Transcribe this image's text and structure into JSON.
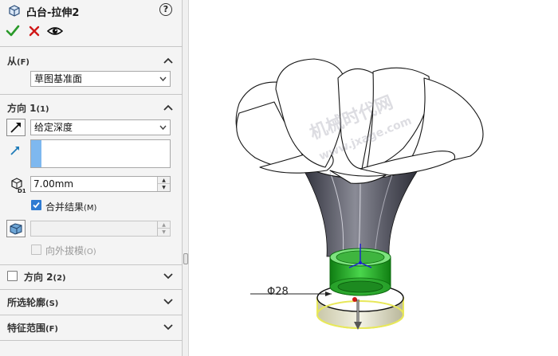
{
  "feature_manager": {
    "title": "凸台-拉伸2",
    "help_symbol": "?"
  },
  "from": {
    "title": "从",
    "hotkey": "(F)",
    "start_condition": "草图基准面"
  },
  "direction1": {
    "title": "方向 1",
    "hotkey": "(1)",
    "end_condition": "给定深度",
    "depth": "7.00mm",
    "merge_result_label": "合并结果",
    "merge_result_hotkey": "(M)",
    "merge_result_checked": true,
    "draft_outward_label": "向外拔模",
    "draft_outward_hotkey": "(O)",
    "draft_outward_checked": false
  },
  "direction2": {
    "title": "方向 2",
    "hotkey": "(2)",
    "checked": false
  },
  "selected_contours": {
    "title": "所选轮廓",
    "hotkey": "(S)"
  },
  "feature_scope": {
    "title": "特征范围",
    "hotkey": "(F)"
  },
  "viewport": {
    "dimension_label": "Φ28",
    "watermark_cn": "机械时代网",
    "watermark_url": "www.jxage.com"
  },
  "colors": {
    "ok_green": "#2a9a2a",
    "cancel_red": "#d01818",
    "preview_green": "#2ec42e",
    "selection_blue": "#7eb8ef",
    "highlight_yellow": "#e8e85a"
  }
}
